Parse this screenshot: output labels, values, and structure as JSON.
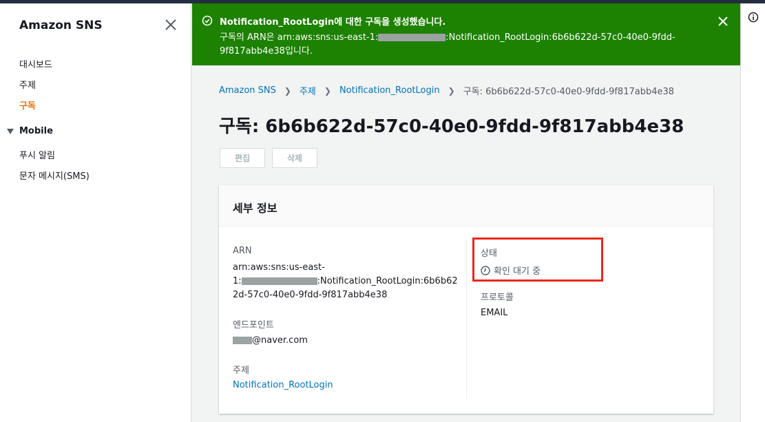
{
  "sidebar": {
    "title": "Amazon SNS",
    "items": [
      {
        "label": "대시보드"
      },
      {
        "label": "주제"
      },
      {
        "label": "구독"
      }
    ],
    "section": {
      "label": "Mobile"
    },
    "sub_items": [
      {
        "label": "푸시 알림"
      },
      {
        "label": "문자 메시지(SMS)"
      }
    ]
  },
  "flash": {
    "title": "Notification_RootLogin에 대한 구독을 생성했습니다.",
    "msg_prefix": "구독의 ARN은 arn:aws:sns:us-east-1:",
    "msg_suffix": ":Notification_RootLogin:6b6b622d-57c0-40e0-9fdd-",
    "msg_line2": "9f817abb4e38입니다.",
    "color": "#1d8102"
  },
  "breadcrumb": {
    "items": [
      "Amazon SNS",
      "주제",
      "Notification_RootLogin"
    ],
    "current": "구독: 6b6b622d-57c0-40e0-9fdd-9f817abb4e38"
  },
  "page": {
    "title": "구독: 6b6b622d-57c0-40e0-9fdd-9f817abb4e38",
    "edit_label": "편집",
    "delete_label": "삭제"
  },
  "details": {
    "title": "세부 정보",
    "arn_label": "ARN",
    "arn_line1": "arn:aws:sns:us-east-",
    "arn_line2_prefix": "1:",
    "arn_line2_suffix": ":Notification_RootLogin:6b6b62",
    "arn_line3": "2d-57c0-40e0-9fdd-9f817abb4e38",
    "endpoint_label": "엔드포인트",
    "endpoint_suffix": "@naver.com",
    "topic_label": "주제",
    "topic_value": "Notification_RootLogin",
    "status_label": "상태",
    "status_value": "확인 대기 중",
    "protocol_label": "프로토콜",
    "protocol_value": "EMAIL"
  }
}
